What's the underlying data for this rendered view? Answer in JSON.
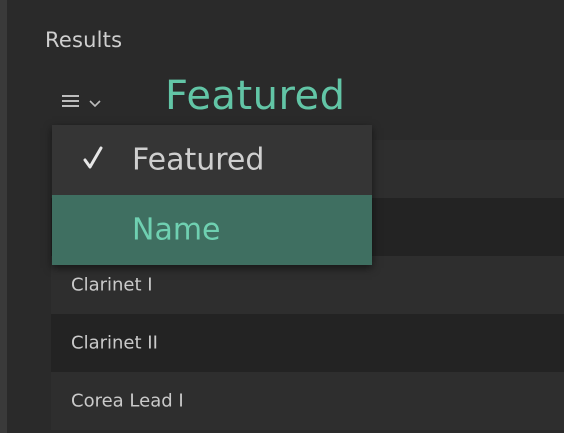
{
  "results_label": "Results",
  "sort": {
    "current": "Featured",
    "menu_icon": "hamburger-menu-icon",
    "chevron_icon": "chevron-down-icon",
    "options": [
      {
        "label": "Featured",
        "checked": true
      },
      {
        "label": "Name",
        "checked": false,
        "highlighted": true
      }
    ]
  },
  "list": {
    "items": [
      {
        "label": "Clarinet I"
      },
      {
        "label": "Clarinet II"
      },
      {
        "label": "Corea Lead I"
      }
    ]
  },
  "colors": {
    "accent": "#62c5a6",
    "highlight": "#3f6f61",
    "background": "#2a2a2a"
  }
}
